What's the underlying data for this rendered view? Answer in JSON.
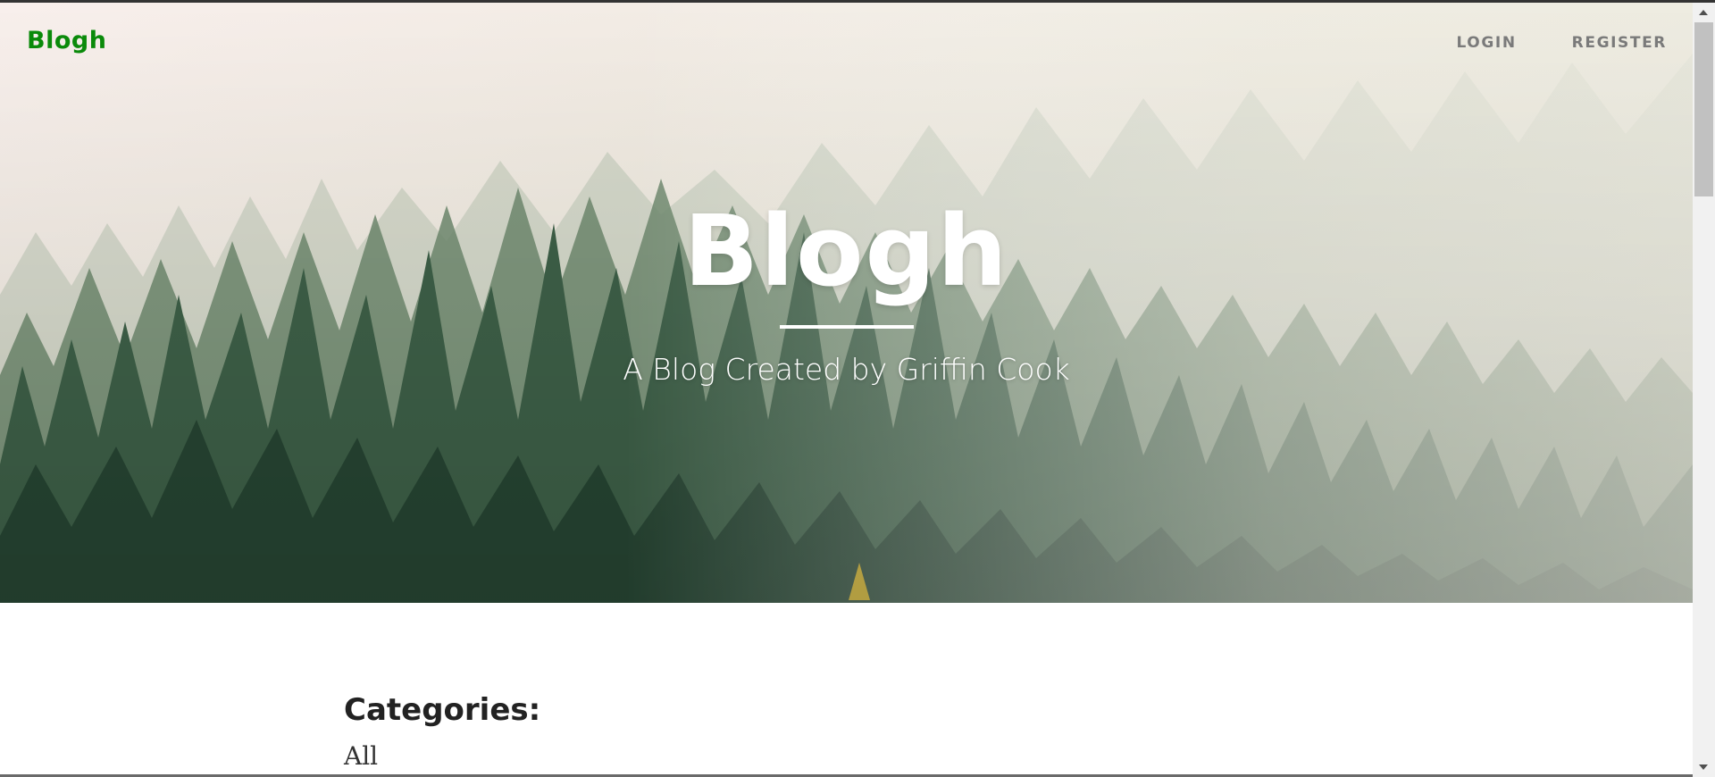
{
  "navbar": {
    "brand": "Blogh",
    "links": [
      "LOGIN",
      "REGISTER"
    ]
  },
  "hero": {
    "title": "Blogh",
    "subtitle": "A Blog Created by Griffin Cook"
  },
  "content": {
    "categories_heading": "Categories:",
    "category_items": [
      "All"
    ]
  },
  "colors": {
    "brand": "#0a8a0a",
    "nav_text": "#7a7a7a",
    "hero_text": "#ffffff",
    "heading_text": "#222222"
  },
  "icons": {
    "scroll_up": "chevron-up-icon",
    "scroll_down": "chevron-down-icon"
  }
}
